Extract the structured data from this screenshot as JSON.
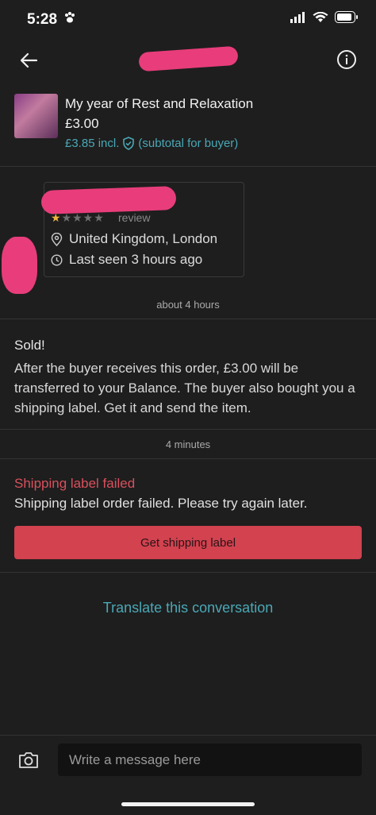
{
  "status_bar": {
    "time": "5:28",
    "icons": [
      "paw-icon",
      "signal-icon",
      "wifi-icon",
      "battery-icon"
    ]
  },
  "nav": {
    "back_icon": "arrow-left-icon",
    "info_icon": "info-icon"
  },
  "item": {
    "title": "My year of Rest and Relaxation",
    "price": "£3.00",
    "price_incl": "£3.85 incl.",
    "price_note": "(subtotal for buyer)"
  },
  "seller": {
    "rating_stars": 1,
    "rating_max": 5,
    "review_label": "review",
    "location": "United Kingdom, London",
    "last_seen": "Last seen 3 hours ago"
  },
  "messages": [
    {
      "timestamp": "about 4 hours",
      "title": "Sold!",
      "body": "After the buyer receives this order, £3.00 will be transferred to your Balance. The buyer also bought you a shipping label. Get it and send the item."
    },
    {
      "timestamp": "4 minutes",
      "title": "Shipping label failed",
      "body": "Shipping label order failed. Please try again later.",
      "button": "Get shipping label"
    }
  ],
  "translate_label": "Translate this conversation",
  "composer": {
    "placeholder": "Write a message here",
    "camera_icon": "camera-icon"
  },
  "colors": {
    "accent": "#4aa8b6",
    "error": "#d9505d",
    "button": "#d2424f",
    "background": "#1e1e1e"
  }
}
